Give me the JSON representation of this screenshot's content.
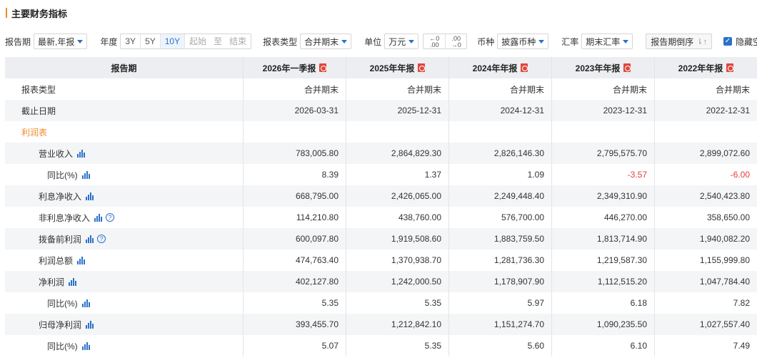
{
  "title": "主要财务指标",
  "toolbar": {
    "period_label": "报告期",
    "period_value": "最新,年报",
    "year_label": "年度",
    "years": [
      "3Y",
      "5Y",
      "10Y"
    ],
    "active_year": "10Y",
    "start_placeholder": "起始",
    "to_text": "至",
    "end_placeholder": "结束",
    "report_type_label": "报表类型",
    "report_type_value": "合并期末",
    "unit_label": "单位",
    "unit_value": "万元",
    "decimal_less": "←0\n.00",
    "decimal_more": ".00\n→0",
    "currency_label": "币种",
    "currency_value": "披露币种",
    "rate_label": "汇率",
    "rate_value": "期末汇率",
    "sort_label": "报告期倒序",
    "hide_empty_label": "隐藏空行"
  },
  "colors": {
    "accent": "#2a72c8",
    "section": "#f08a2a",
    "negative": "#e23d3d"
  },
  "table": {
    "header_label": "报告期",
    "columns": [
      "2026年一季报",
      "2025年年报",
      "2024年年报",
      "2023年年报",
      "2022年年报"
    ],
    "rows": [
      {
        "label": "报表类型",
        "indent": 0,
        "values": [
          "合并期末",
          "合并期末",
          "合并期末",
          "合并期末",
          "合并期末"
        ]
      },
      {
        "label": "截止日期",
        "indent": 0,
        "values": [
          "2026-03-31",
          "2025-12-31",
          "2024-12-31",
          "2023-12-31",
          "2022-12-31"
        ]
      },
      {
        "label": "利润表",
        "indent": 0,
        "section": true,
        "values": [
          "",
          "",
          "",
          "",
          ""
        ]
      },
      {
        "label": "营业收入",
        "indent": 1,
        "chart": true,
        "values": [
          "783,005.80",
          "2,864,829.30",
          "2,826,146.30",
          "2,795,575.70",
          "2,899,072.60"
        ]
      },
      {
        "label": "同比(%)",
        "indent": 2,
        "chart": true,
        "values": [
          "8.39",
          "1.37",
          "1.09",
          "-3.57",
          "-6.00"
        ]
      },
      {
        "label": "利息净收入",
        "indent": 1,
        "chart": true,
        "values": [
          "668,795.00",
          "2,426,065.00",
          "2,249,448.40",
          "2,349,310.90",
          "2,540,423.80"
        ]
      },
      {
        "label": "非利息净收入",
        "indent": 1,
        "chart": true,
        "help": true,
        "values": [
          "114,210.80",
          "438,760.00",
          "576,700.00",
          "446,270.00",
          "358,650.00"
        ]
      },
      {
        "label": "拨备前利润",
        "indent": 1,
        "chart": true,
        "help": true,
        "values": [
          "600,097.80",
          "1,919,508.60",
          "1,883,759.50",
          "1,813,714.90",
          "1,940,082.20"
        ]
      },
      {
        "label": "利润总额",
        "indent": 1,
        "chart": true,
        "values": [
          "474,763.40",
          "1,370,938.70",
          "1,281,736.30",
          "1,219,587.30",
          "1,155,999.80"
        ]
      },
      {
        "label": "净利润",
        "indent": 1,
        "chart": true,
        "values": [
          "402,127.80",
          "1,242,000.50",
          "1,178,907.90",
          "1,112,515.20",
          "1,047,784.40"
        ]
      },
      {
        "label": "同比(%)",
        "indent": 2,
        "chart": true,
        "values": [
          "5.35",
          "5.35",
          "5.97",
          "6.18",
          "7.82"
        ]
      },
      {
        "label": "归母净利润",
        "indent": 1,
        "chart": true,
        "values": [
          "393,455.70",
          "1,212,842.10",
          "1,151,274.70",
          "1,090,235.50",
          "1,027,557.40"
        ]
      },
      {
        "label": "同比(%)",
        "indent": 2,
        "chart": true,
        "values": [
          "5.07",
          "5.35",
          "5.60",
          "6.10",
          "7.49"
        ]
      }
    ]
  }
}
